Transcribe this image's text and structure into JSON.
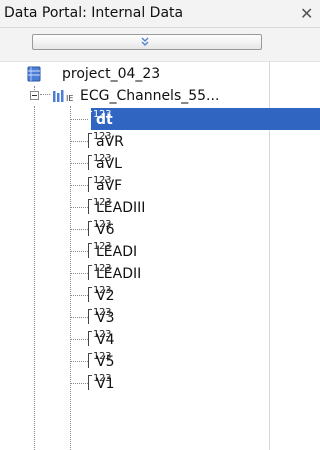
{
  "window": {
    "title": "Data Portal: Internal Data",
    "close_glyph": "✕"
  },
  "toolbar": {
    "collapse_icon": "double-chevron-down-icon"
  },
  "tree": {
    "project": {
      "label": "project_04_23",
      "icon": "database-icon"
    },
    "group": {
      "label": "ECG_Channels_55...",
      "icon": "channel-group-icon",
      "expanded": true
    },
    "channel_icon_text": "123",
    "channels": [
      {
        "label": "dt",
        "selected": true
      },
      {
        "label": "aVR"
      },
      {
        "label": "aVL"
      },
      {
        "label": "aVF"
      },
      {
        "label": "LEADIII"
      },
      {
        "label": "V6"
      },
      {
        "label": "LEADI"
      },
      {
        "label": "LEADII"
      },
      {
        "label": "V2"
      },
      {
        "label": "V3"
      },
      {
        "label": "V4"
      },
      {
        "label": "V5"
      },
      {
        "label": "V1"
      }
    ]
  },
  "colors": {
    "selection": "#3066c2",
    "tree_lines": "#8a8a8a"
  }
}
